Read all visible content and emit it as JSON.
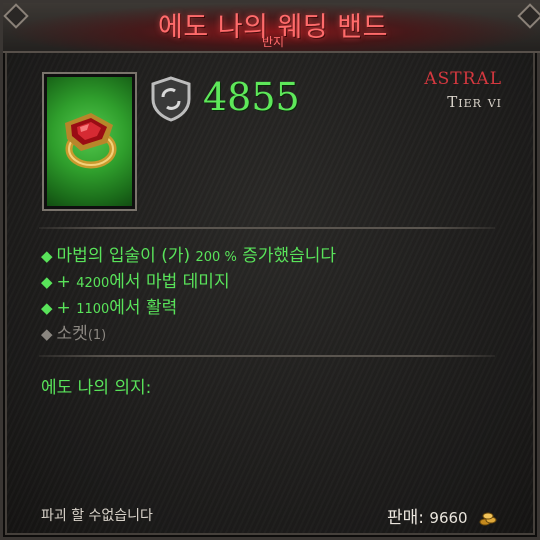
{
  "item": {
    "name": "에도 나의 웨딩 밴드",
    "type": "반지",
    "image_icon": "gold-ring-red-gem-icon",
    "power": "4855",
    "rarity": "ASTRAL",
    "tier": "Tier vi"
  },
  "affixes": [
    {
      "bullet": "◆",
      "text": "마법의 입술이 (가) ",
      "value": "200 %",
      "suffix": " 증가했습니다"
    },
    {
      "bullet": "◆",
      "text": "+ ",
      "value": "4200",
      "suffix": "에서 마법 데미지"
    },
    {
      "bullet": "◆",
      "text": "+ ",
      "value": "1100",
      "suffix": "에서 활력"
    },
    {
      "bullet": "◆",
      "text": "소켓",
      "value": "(1)",
      "suffix": ""
    }
  ],
  "set_heading": "에도 나의 의지:",
  "footer": {
    "note": "파괴 할 수없습니다",
    "sell_label": "판매:",
    "sell_value": "9660"
  },
  "colors": {
    "affix_green": "#59e35a",
    "rarity_red": "#d5383f",
    "title_red": "#ff6b6b"
  }
}
